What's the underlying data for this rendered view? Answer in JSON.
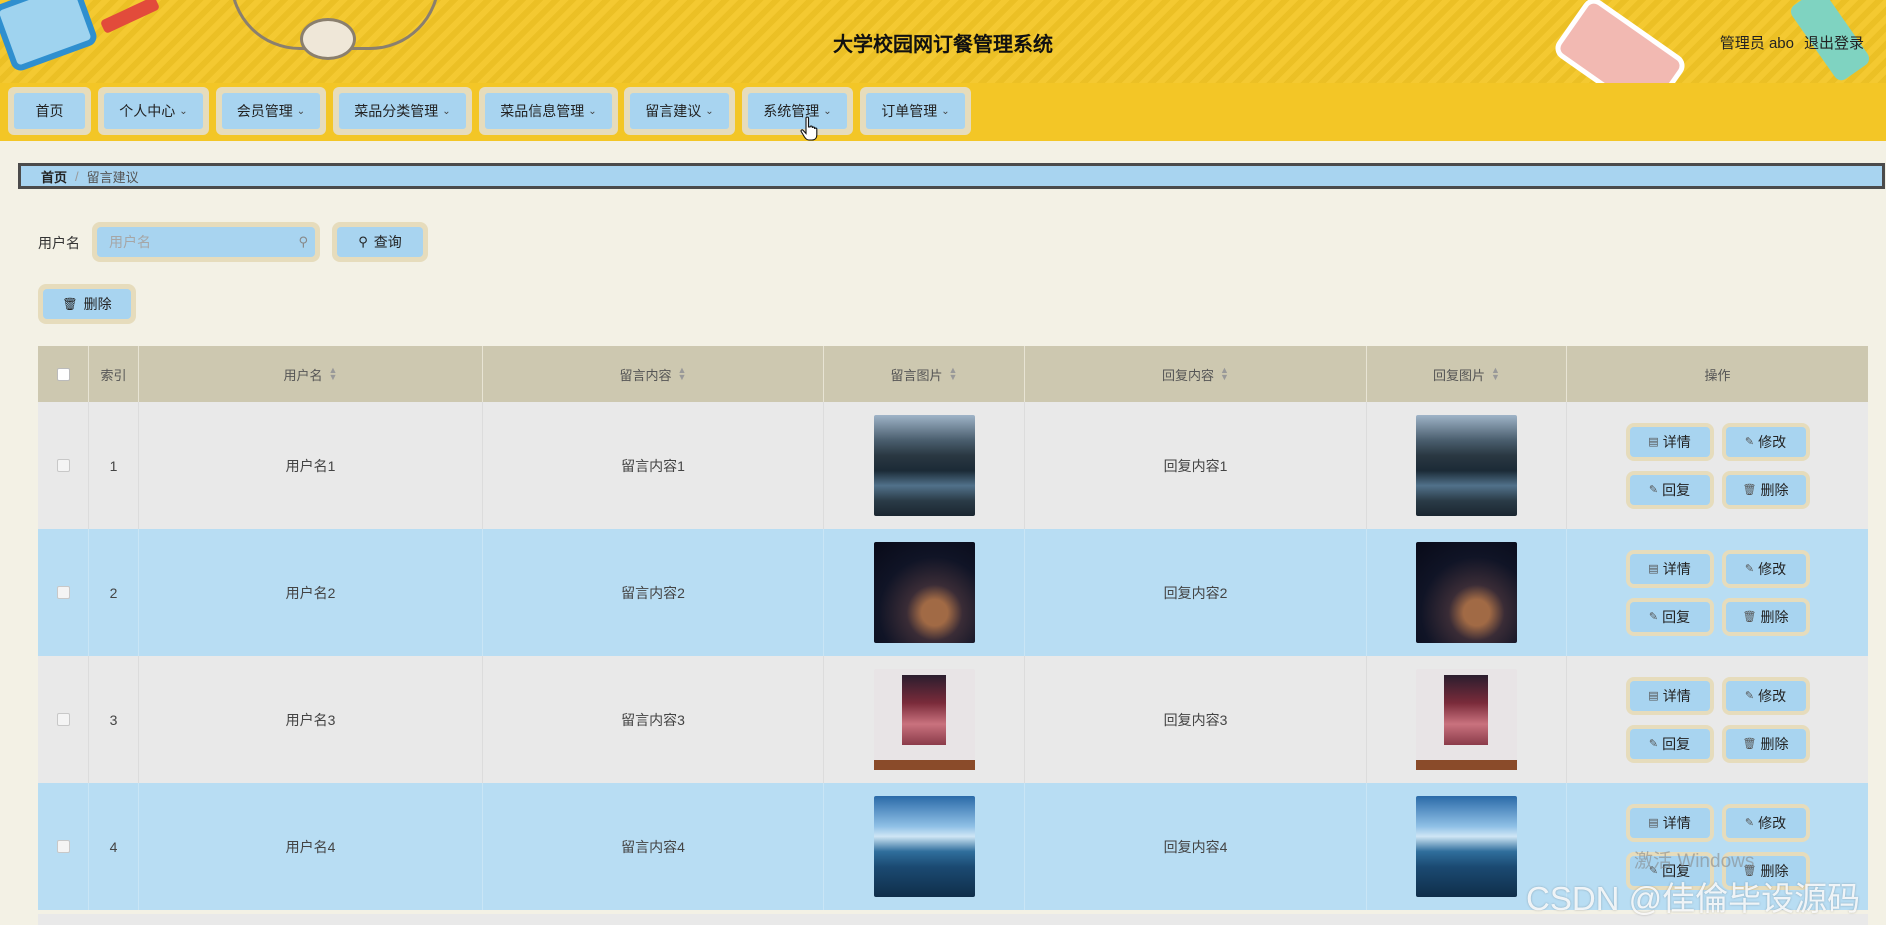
{
  "header": {
    "title": "大学校园网订餐管理系统",
    "user": "管理员 abo",
    "logout": "退出登录"
  },
  "nav": [
    {
      "label": "首页",
      "dropdown": false
    },
    {
      "label": "个人中心",
      "dropdown": true
    },
    {
      "label": "会员管理",
      "dropdown": true
    },
    {
      "label": "菜品分类管理",
      "dropdown": true
    },
    {
      "label": "菜品信息管理",
      "dropdown": true
    },
    {
      "label": "留言建议",
      "dropdown": true
    },
    {
      "label": "系统管理",
      "dropdown": true
    },
    {
      "label": "订单管理",
      "dropdown": true
    }
  ],
  "breadcrumb": {
    "home": "首页",
    "separator": "/",
    "current": "留言建议"
  },
  "search": {
    "label": "用户名",
    "placeholder": "用户名",
    "value": "",
    "button": "查询"
  },
  "toolbar": {
    "delete": "删除"
  },
  "table": {
    "headers": {
      "index": "索引",
      "username": "用户名",
      "content": "留言内容",
      "image": "留言图片",
      "reply": "回复内容",
      "reply_image": "回复图片",
      "actions": "操作"
    },
    "rows": [
      {
        "index": "1",
        "username": "用户名1",
        "content": "留言内容1",
        "reply": "回复内容1",
        "image": "river-valley",
        "reply_image": "river-valley"
      },
      {
        "index": "2",
        "username": "用户名2",
        "content": "留言内容2",
        "reply": "回复内容2",
        "image": "jar-of-stars",
        "reply_image": "jar-of-stars"
      },
      {
        "index": "3",
        "username": "用户名3",
        "content": "留言内容3",
        "reply": "回复内容3",
        "image": "framed-painting",
        "reply_image": "framed-painting"
      },
      {
        "index": "4",
        "username": "用户名4",
        "content": "留言内容4",
        "reply": "回复内容4",
        "image": "mountain-lake",
        "reply_image": "mountain-lake"
      }
    ],
    "actions": {
      "detail": "详情",
      "edit": "修改",
      "reply": "回复",
      "delete": "删除"
    }
  },
  "watermarks": {
    "windows": "激活 Windows",
    "csdn": "CSDN @佳倫毕设源码"
  },
  "colors": {
    "header_bg": "#f3c626",
    "button_bg": "#a8d4f0",
    "button_border": "#e6dcbc",
    "row_alt": "#b8ddf3",
    "table_header": "#cdc8b0",
    "page_bg": "#f3f1e5"
  }
}
